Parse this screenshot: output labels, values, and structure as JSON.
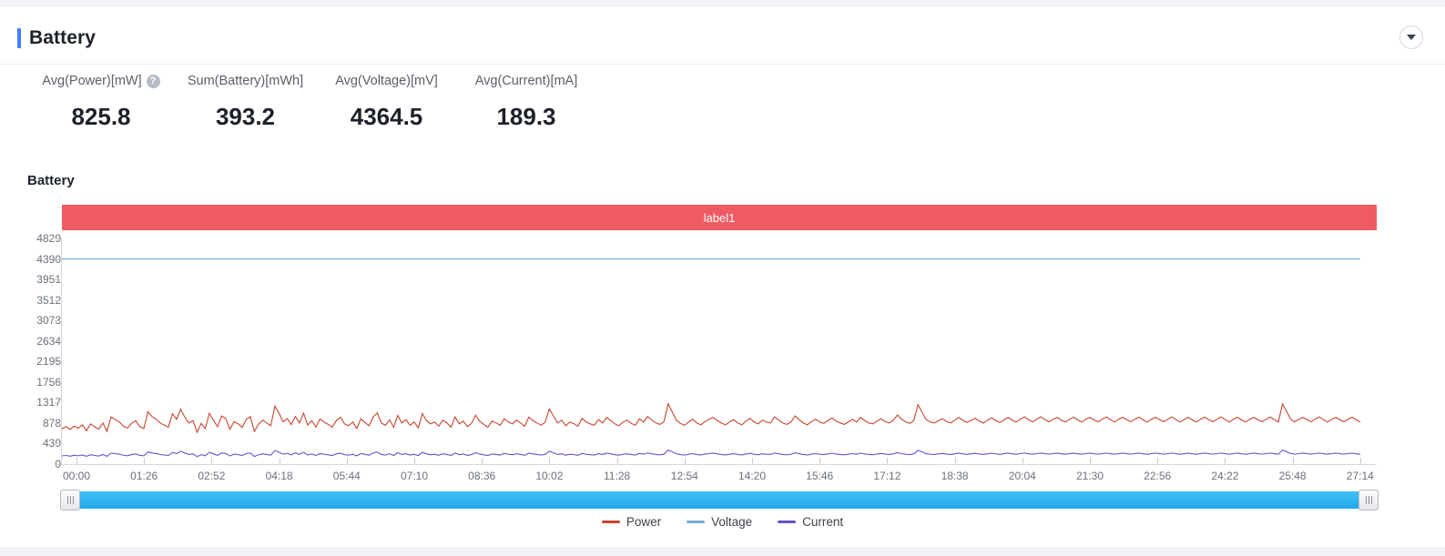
{
  "panel": {
    "title": "Battery",
    "collapse_icon": "chevron-down-icon",
    "accent_color": "#4080ff"
  },
  "kpis": [
    {
      "label": "Avg(Power)[mW]",
      "value": "825.8",
      "help_icon": "question-mark-icon",
      "has_help": true
    },
    {
      "label": "Sum(Battery)[mWh]",
      "value": "393.2",
      "has_help": false
    },
    {
      "label": "Avg(Voltage)[mV]",
      "value": "4364.5",
      "has_help": false
    },
    {
      "label": "Avg(Current)[mA]",
      "value": "189.3",
      "has_help": false
    }
  ],
  "chart_title": "Battery",
  "label_band": {
    "text": "label1",
    "color": "#ef5b62"
  },
  "slider": {
    "grip_icon": "drag-handle-icon",
    "track_color": "#29b6f6",
    "start_pct": 0,
    "end_pct": 100
  },
  "chart_data": {
    "type": "line",
    "title": "Battery",
    "xlabel": "",
    "ylabel": "",
    "grid": false,
    "legend_position": "bottom",
    "ylim": [
      0,
      4829
    ],
    "yticks": [
      0,
      439,
      878,
      1317,
      1756,
      2195,
      2634,
      3073,
      3512,
      3951,
      4390,
      4829
    ],
    "ytick_labels": [
      "0",
      "439",
      "878",
      "1317",
      "1756",
      "2195",
      "2634",
      "3073",
      "3512",
      "3951",
      "4390",
      "4829"
    ],
    "xtick_labels": [
      "00:00",
      "01:26",
      "02:52",
      "04:18",
      "05:44",
      "07:10",
      "08:36",
      "10:02",
      "11:28",
      "12:54",
      "14:20",
      "15:46",
      "17:12",
      "18:38",
      "20:04",
      "21:30",
      "22:56",
      "24:22",
      "25:48",
      "27:14"
    ],
    "series": [
      {
        "name": "Power",
        "color": "#c6452f",
        "unit": "mW",
        "mean": 825.8,
        "values": [
          760,
          800,
          742,
          815,
          770,
          838,
          712,
          860,
          795,
          748,
          880,
          700,
          1010,
          950,
          905,
          812,
          770,
          870,
          930,
          805,
          760,
          1120,
          1015,
          960,
          880,
          835,
          790,
          1080,
          960,
          1175,
          1005,
          880,
          930,
          680,
          870,
          760,
          1090,
          935,
          800,
          1030,
          975,
          745,
          905,
          865,
          785,
          960,
          1015,
          700,
          855,
          940,
          880,
          820,
          1240,
          1090,
          905,
          975,
          845,
          1020,
          880,
          1090,
          835,
          930,
          790,
          965,
          900,
          850,
          790,
          930,
          1005,
          860,
          820,
          900,
          760,
          970,
          890,
          820,
          1010,
          1095,
          880,
          830,
          945,
          790,
          1040,
          880,
          950,
          830,
          900,
          775,
          1080,
          930,
          860,
          900,
          810,
          940,
          880,
          790,
          1010,
          860,
          920,
          800,
          870,
          1045,
          920,
          850,
          790,
          920,
          880,
          830,
          970,
          900,
          860,
          940,
          880,
          810,
          1005,
          930,
          880,
          830,
          900,
          1180,
          1030,
          880,
          940,
          820,
          900,
          865,
          810,
          980,
          900,
          860,
          830,
          950,
          880,
          1000,
          930,
          860,
          820,
          900,
          940,
          870,
          830,
          970,
          900,
          1020,
          940,
          880,
          850,
          910,
          1290,
          1120,
          940,
          870,
          830,
          900,
          960,
          880,
          840,
          910,
          960,
          1000,
          930,
          880,
          840,
          900,
          950,
          880,
          840,
          920,
          980,
          900,
          860,
          940,
          900,
          880,
          1010,
          940,
          880,
          850,
          900,
          1030,
          950,
          880,
          840,
          910,
          960,
          900,
          870,
          930,
          990,
          920,
          880,
          850,
          900,
          960,
          900,
          1000,
          930,
          880,
          860,
          920,
          970,
          910,
          880,
          940,
          1050,
          960,
          900,
          870,
          930,
          1270,
          1110,
          950,
          900,
          880,
          930,
          970,
          910,
          880,
          940,
          1000,
          930,
          890,
          940,
          980,
          920,
          880,
          940,
          990,
          930,
          890,
          950,
          1000,
          940,
          900,
          960,
          1010,
          950,
          900,
          960,
          1015,
          950,
          905,
          960,
          1000,
          940,
          900,
          955,
          1005,
          945,
          900,
          960,
          1000,
          945,
          905,
          960,
          1010,
          950,
          900,
          960,
          1000,
          950,
          905,
          965,
          1005,
          945,
          900,
          960,
          1000,
          950,
          905,
          960,
          1010,
          950,
          900,
          955,
          1000,
          945,
          900,
          960,
          1005,
          950,
          905,
          960,
          1010,
          950,
          900,
          960,
          1005,
          945,
          900,
          960,
          1000,
          950,
          905,
          960,
          1010,
          950,
          900,
          1290,
          1130,
          960,
          905,
          960,
          1000,
          950,
          905,
          965,
          1010,
          950,
          900,
          960,
          1000,
          950,
          905,
          960,
          1005,
          945,
          900
        ]
      },
      {
        "name": "Voltage",
        "color": "#7eaadb",
        "unit": "mV",
        "mean": 4364.5,
        "flat_value": 4390,
        "values": [
          4390,
          4390,
          4390,
          4390,
          4390,
          4390,
          4390,
          4390,
          4390,
          4390,
          4390,
          4390,
          4390,
          4390,
          4390,
          4390,
          4390,
          4390,
          4390,
          4390
        ]
      },
      {
        "name": "Current",
        "color": "#6655c8",
        "unit": "mA",
        "mean": 189.3,
        "values": [
          175,
          185,
          170,
          190,
          178,
          195,
          168,
          200,
          185,
          172,
          205,
          165,
          235,
          222,
          212,
          190,
          180,
          203,
          218,
          188,
          178,
          260,
          238,
          224,
          206,
          195,
          184,
          252,
          224,
          274,
          235,
          206,
          218,
          160,
          203,
          178,
          254,
          218,
          187,
          240,
          228,
          174,
          212,
          202,
          183,
          224,
          237,
          164,
          200,
          220,
          206,
          192,
          290,
          254,
          212,
          228,
          198,
          238,
          206,
          254,
          195,
          218,
          185,
          225,
          210,
          199,
          185,
          218,
          235,
          201,
          192,
          210,
          178,
          227,
          208,
          192,
          236,
          256,
          206,
          194,
          221,
          185,
          243,
          206,
          222,
          194,
          210,
          181,
          252,
          218,
          201,
          210,
          189,
          220,
          206,
          185,
          236,
          201,
          215,
          187,
          203,
          244,
          215,
          199,
          185,
          215,
          206,
          194,
          227,
          210,
          201,
          220,
          206,
          189,
          235,
          218,
          206,
          194,
          210,
          276,
          241,
          206,
          220,
          192,
          210,
          202,
          189,
          229,
          210,
          201,
          194,
          222,
          206,
          234,
          218,
          201,
          192,
          210,
          220,
          203,
          194,
          227,
          210,
          238,
          220,
          206,
          199,
          213,
          301,
          262,
          220,
          203,
          194,
          210,
          224,
          206,
          196,
          213,
          224,
          234,
          218,
          206,
          196,
          210,
          222,
          206,
          196,
          215,
          229,
          210,
          201,
          220,
          210,
          206,
          236,
          220,
          206,
          199,
          210,
          241,
          222,
          206,
          196,
          213,
          224,
          210,
          203,
          218,
          231,
          215,
          206,
          199,
          210,
          224,
          210,
          234,
          218,
          206,
          201,
          215,
          227,
          213,
          206,
          220,
          245,
          224,
          210,
          203,
          218,
          297,
          260,
          222,
          210,
          206,
          218,
          227,
          213,
          206,
          220,
          234,
          218,
          208,
          220,
          229,
          215,
          206,
          220,
          231,
          218,
          208,
          222,
          234,
          220,
          210,
          224,
          236,
          222,
          210,
          224,
          237,
          222,
          212,
          224,
          234,
          220,
          210,
          223,
          235,
          221,
          210,
          224,
          234,
          221,
          212,
          224,
          236,
          222,
          210,
          224,
          234,
          222,
          212,
          226,
          235,
          221,
          210,
          224,
          234,
          222,
          212,
          224,
          236,
          222,
          210,
          223,
          234,
          221,
          210,
          224,
          235,
          222,
          212,
          224,
          236,
          222,
          210,
          224,
          235,
          221,
          210,
          224,
          234,
          222,
          212,
          224,
          236,
          222,
          210,
          301,
          264,
          224,
          212,
          224,
          234,
          222,
          212,
          226,
          236,
          222,
          210,
          224,
          234,
          222,
          212,
          224,
          235,
          221,
          210
        ]
      }
    ]
  },
  "legend": [
    {
      "label": "Power",
      "color": "#c6452f"
    },
    {
      "label": "Voltage",
      "color": "#7eaadb"
    },
    {
      "label": "Current",
      "color": "#6655c8"
    }
  ]
}
